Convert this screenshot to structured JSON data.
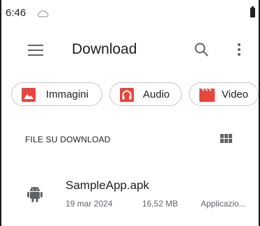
{
  "status_bar": {
    "time": "6:46",
    "cloud_icon": "cloud-outline-icon",
    "battery_icon": "battery-icon"
  },
  "app_bar": {
    "title": "Download",
    "menu_icon": "hamburger-menu-icon",
    "search_icon": "search-icon",
    "more_icon": "more-vertical-icon"
  },
  "chips": [
    {
      "label": "Immagini",
      "icon": "image-icon",
      "color": "#e8453c"
    },
    {
      "label": "Audio",
      "icon": "headphones-icon",
      "color": "#e8453c"
    },
    {
      "label": "Video",
      "icon": "movie-clapper-icon",
      "color": "#e8453c"
    }
  ],
  "section": {
    "title": "FILE SU DOWNLOAD",
    "view_icon": "grid-view-icon"
  },
  "files": [
    {
      "name": "SampleApp.apk",
      "date": "19 mar 2024",
      "size": "16,52 MB",
      "type": "Applicazio...",
      "icon": "android-icon"
    }
  ],
  "colors": {
    "accent_red": "#e8453c",
    "android_icon": "#5f6368",
    "text_primary": "#202124",
    "text_secondary": "#5f6368",
    "chip_border": "#c6c6c6"
  }
}
